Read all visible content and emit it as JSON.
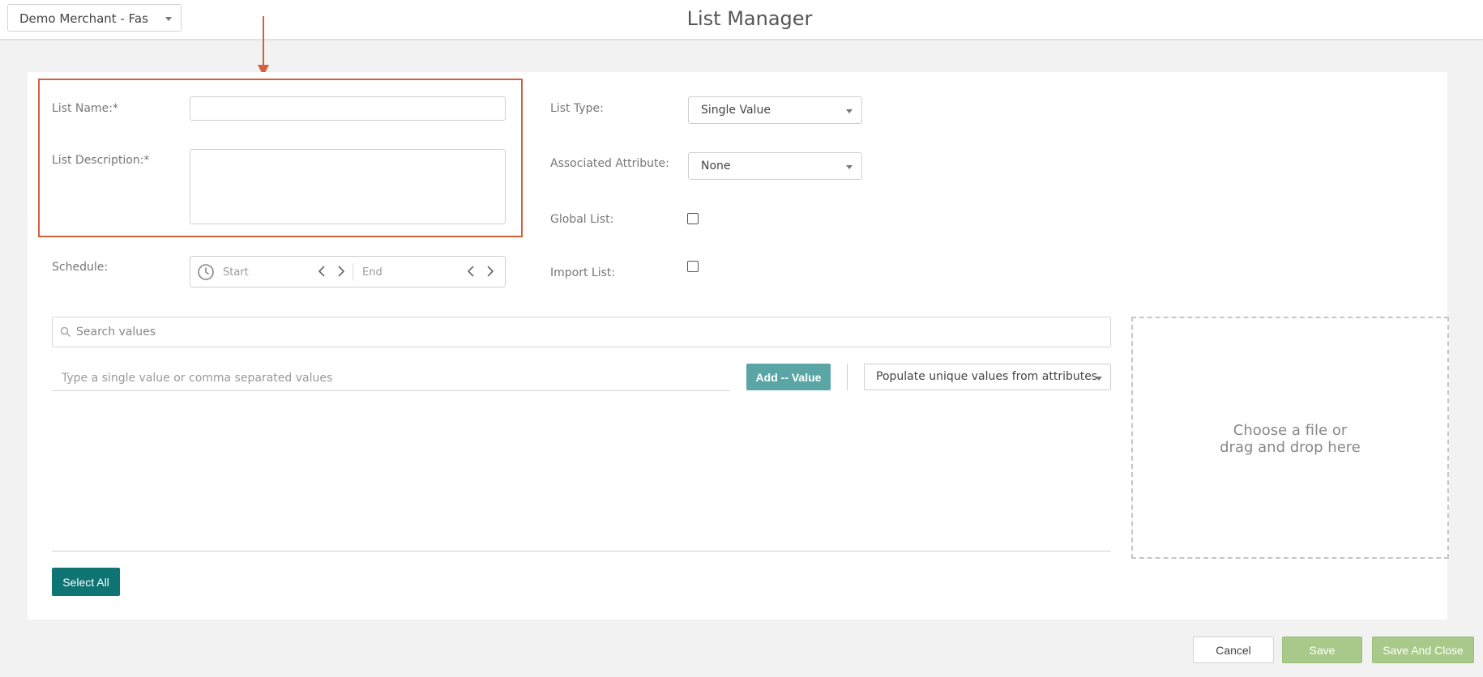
{
  "header": {
    "merchant_selector": "Demo Merchant - Fashion",
    "title": "List Manager"
  },
  "form": {
    "list_name_label": "List Name:*",
    "list_description_label": "List Description:*",
    "schedule_label": "Schedule:",
    "schedule_start_placeholder": "Start",
    "schedule_end_placeholder": "End",
    "list_type_label": "List Type:",
    "list_type_value": "Single Value",
    "associated_attribute_label": "Associated Attribute:",
    "associated_attribute_value": "None",
    "global_list_label": "Global List:",
    "global_list_checked": false,
    "import_list_label": "Import List:",
    "import_list_checked": false
  },
  "values": {
    "search_placeholder": "Search values",
    "value_input_placeholder": "Type a single value or comma separated values",
    "add_button": "Add -- Value",
    "populate_select": "Populate unique values from attributes",
    "select_all_button": "Select All"
  },
  "dropzone": {
    "line1": "Choose a file or",
    "line2": "drag and drop here"
  },
  "footer": {
    "cancel": "Cancel",
    "save": "Save",
    "save_and_close": "Save And Close"
  },
  "colors": {
    "annotation": "#d6603d",
    "add_button": "#5aa6a6",
    "select_all": "#0e7474",
    "save_buttons": "#a9c98b"
  }
}
